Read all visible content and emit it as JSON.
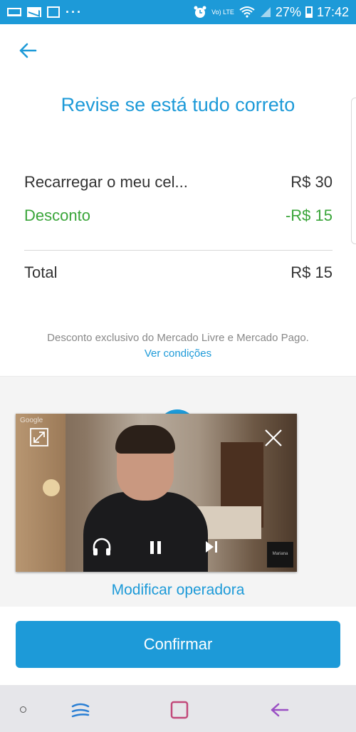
{
  "status_bar": {
    "battery_percent": "27%",
    "time": "17:42",
    "volte_label": "Vo) LTE",
    "dots": "···"
  },
  "header": {
    "title": "Revise se está tudo correto"
  },
  "summary": {
    "item_label": "Recarregar o meu cel...",
    "item_value": "R$ 30",
    "discount_label": "Desconto",
    "discount_value": "-R$ 15",
    "total_label": "Total",
    "total_value": "R$ 15"
  },
  "disclaimer": {
    "text": "Desconto exclusivo do Mercado Livre e Mercado Pago.",
    "link": "Ver condições"
  },
  "video": {
    "watermark": "Google",
    "thumbnail_label": "Mariana"
  },
  "operator": {
    "modify_label": "Modificar operadora"
  },
  "actions": {
    "confirm_label": "Confirmar"
  },
  "colors": {
    "accent": "#1d9ad8",
    "discount_green": "#3aa53a",
    "text_dark": "#333333",
    "text_muted": "#888888"
  },
  "icons": {
    "back": "arrow-left-icon",
    "expand": "expand-icon",
    "close": "close-icon",
    "headphones": "headphones-icon",
    "pause": "pause-icon",
    "next": "skip-next-icon"
  }
}
